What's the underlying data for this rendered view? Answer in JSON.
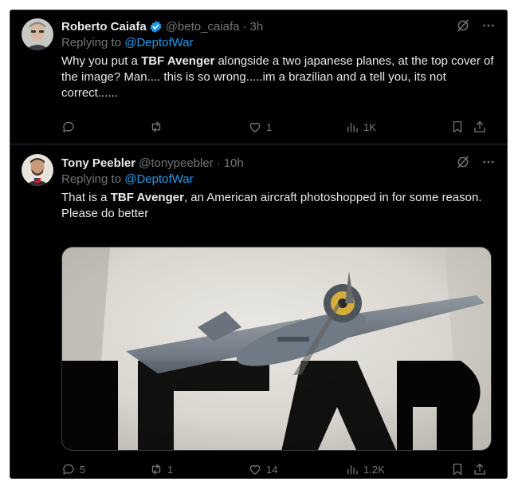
{
  "tweets": [
    {
      "author_name": "Roberto Caiafa",
      "handle": "@beto_caiafa",
      "separator": "·",
      "time": "3h",
      "replying_prefix": "Replying to",
      "replying_to": "@DeptofWar",
      "text_parts": [
        "Why you put a ",
        "TBF Avenger",
        " alongside a two japanese planes, at the top cover of the image? Man.... this is so wrong.....im a brazilian and a tell you, its not correct......"
      ],
      "counts": {
        "replies": "",
        "reposts": "",
        "likes": "1",
        "views": "1K"
      },
      "verified": true
    },
    {
      "author_name": "Tony Peebler",
      "handle": "@tonypeebler",
      "separator": "·",
      "time": "10h",
      "replying_prefix": "Replying to",
      "replying_to": "@DeptofWar",
      "text_parts": [
        "That is a ",
        "TBF Avenger",
        ", an American aircraft photoshopped in for some reason. Please do better"
      ],
      "counts": {
        "replies": "5",
        "reposts": "1",
        "likes": "14",
        "views": "1.2K"
      },
      "verified": false
    }
  ],
  "icons": {
    "verified": "verified-badge-icon",
    "grok": "grok-icon",
    "more": "more-icon",
    "reply": "reply-icon",
    "repost": "repost-icon",
    "like": "heart-icon",
    "views": "views-icon",
    "bookmark": "bookmark-icon",
    "share": "share-icon"
  },
  "colors": {
    "background": "#000000",
    "primary_text": "#e7e9ea",
    "secondary_text": "#71767b",
    "accent": "#1d9bf0",
    "divider": "#2f3336"
  }
}
